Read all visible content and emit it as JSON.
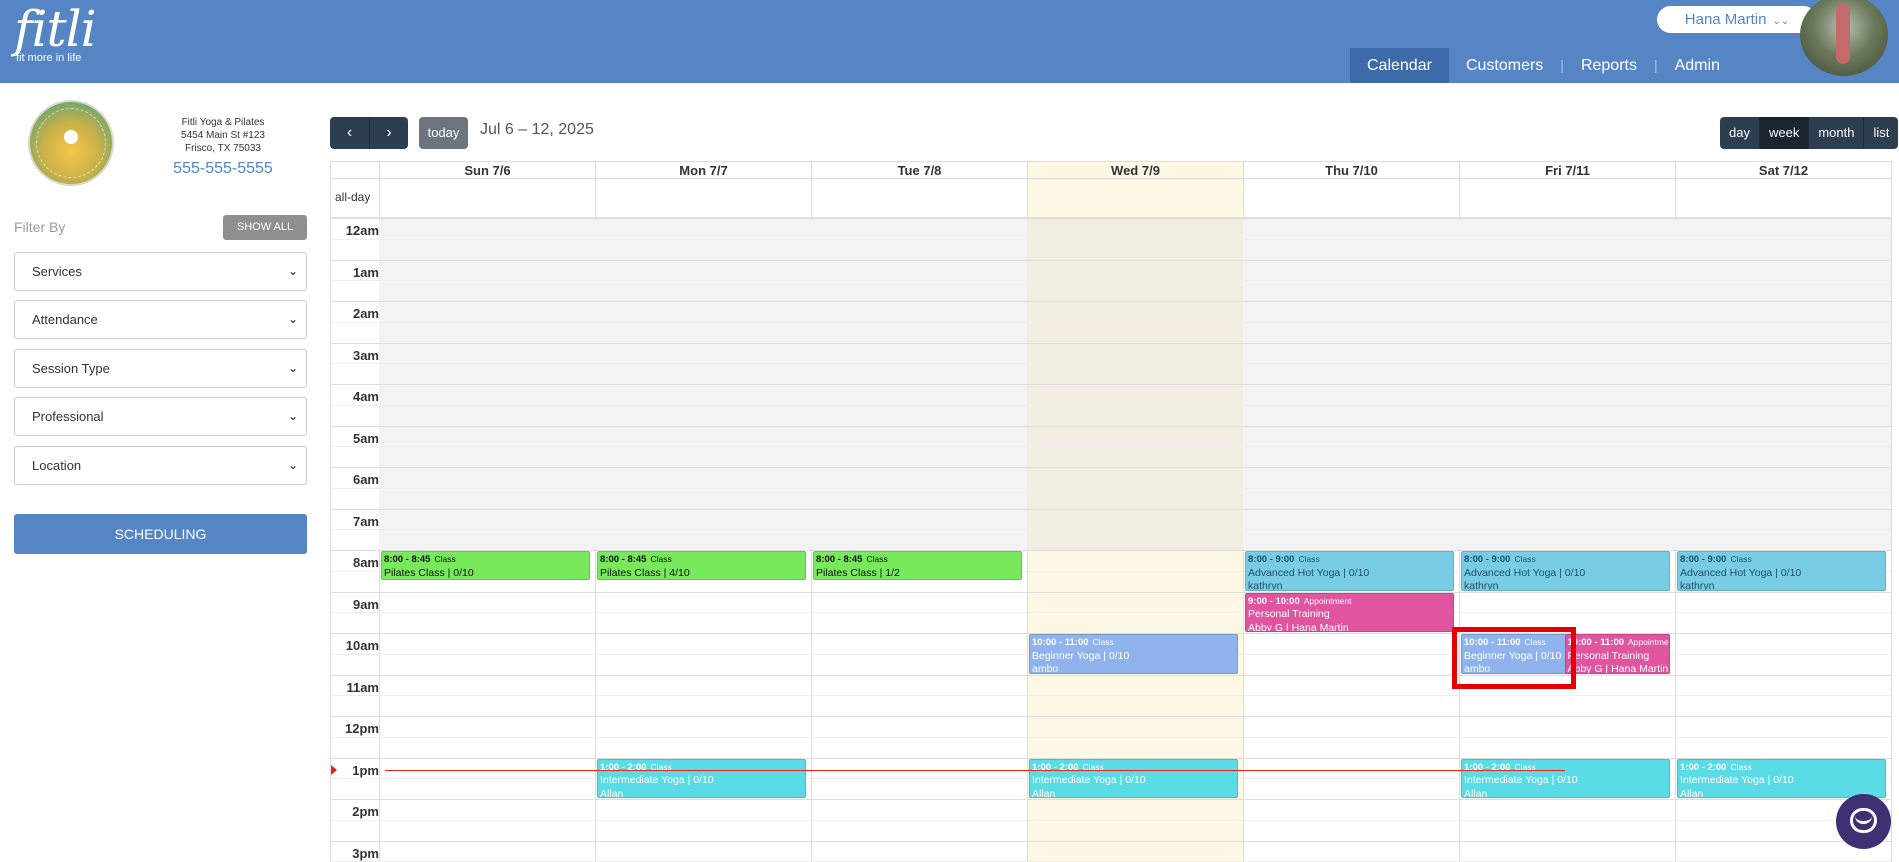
{
  "brand": {
    "name": "fitli",
    "tagline": "fit more in life"
  },
  "user": {
    "name": "Hana Martin"
  },
  "nav": {
    "items": [
      "Calendar",
      "Customers",
      "Reports",
      "Admin"
    ],
    "active": "Calendar"
  },
  "studio": {
    "name": "Fitli Yoga & Pilates",
    "address1": "5454 Main St #123",
    "address2": "Frisco, TX 75033",
    "phone": "555-555-5555"
  },
  "filters": {
    "label": "Filter By",
    "show_all": "SHOW ALL",
    "selects": [
      "Services",
      "Attendance",
      "Session Type",
      "Professional",
      "Location"
    ]
  },
  "scheduling_label": "SCHEDULING",
  "toolbar": {
    "prev": "‹",
    "next": "›",
    "today": "today",
    "range": "Jul 6 – 12, 2025",
    "views": [
      "day",
      "week",
      "month",
      "list"
    ],
    "active_view": "week"
  },
  "calendar": {
    "days": [
      "Sun 7/6",
      "Mon 7/7",
      "Tue 7/8",
      "Wed 7/9",
      "Thu 7/10",
      "Fri 7/11",
      "Sat 7/12"
    ],
    "today_index": 3,
    "allday_label": "all-day",
    "hours": [
      "12am",
      "1am",
      "2am",
      "3am",
      "4am",
      "5am",
      "6am",
      "7am",
      "8am",
      "9am",
      "10am",
      "11am",
      "12pm",
      "1pm",
      "2pm",
      "3pm"
    ],
    "events": [
      {
        "day": 0,
        "start": 8,
        "end": 8.75,
        "time": "8:00 - 8:45",
        "kind": "Class",
        "line1": "Pilates Class | 0/10",
        "line2": "",
        "color": "green"
      },
      {
        "day": 1,
        "start": 8,
        "end": 8.75,
        "time": "8:00 - 8:45",
        "kind": "Class",
        "line1": "Pilates Class | 4/10",
        "line2": "",
        "color": "green"
      },
      {
        "day": 2,
        "start": 8,
        "end": 8.75,
        "time": "8:00 - 8:45",
        "kind": "Class",
        "line1": "Pilates Class | 1/2",
        "line2": "",
        "color": "green"
      },
      {
        "day": 4,
        "start": 8,
        "end": 9,
        "time": "8:00 - 9:00",
        "kind": "Class",
        "line1": "Advanced Hot Yoga | 0/10",
        "line2": "kathryn",
        "color": "blue"
      },
      {
        "day": 5,
        "start": 8,
        "end": 9,
        "time": "8:00 - 9:00",
        "kind": "Class",
        "line1": "Advanced Hot Yoga | 0/10",
        "line2": "kathryn",
        "color": "blue"
      },
      {
        "day": 6,
        "start": 8,
        "end": 9,
        "time": "8:00 - 9:00",
        "kind": "Class",
        "line1": "Advanced Hot Yoga | 0/10",
        "line2": "kathryn",
        "color": "blue"
      },
      {
        "day": 4,
        "start": 9,
        "end": 10,
        "time": "9:00 - 10:00",
        "kind": "Appointment",
        "line1": "Personal Training",
        "line2": "Abby G | Hana Martin",
        "color": "pink"
      },
      {
        "day": 3,
        "start": 10,
        "end": 11,
        "time": "10:00 - 11:00",
        "kind": "Class",
        "line1": "Beginner Yoga | 0/10",
        "line2": "ambo",
        "color": "lblue"
      },
      {
        "day": 5,
        "start": 10,
        "end": 11,
        "time": "10:00 - 11:00",
        "kind": "Class",
        "line1": "Beginner Yoga | 0/10",
        "line2": "ambo",
        "color": "lblue",
        "slot": 0
      },
      {
        "day": 5,
        "start": 10,
        "end": 11,
        "time": "10:00 - 11:00",
        "kind": "Appointment",
        "line1": "Personal Training",
        "line2": "Abby G | Hana Martin",
        "color": "pink",
        "slot": 1
      },
      {
        "day": 1,
        "start": 13,
        "end": 14,
        "time": "1:00 - 2:00",
        "kind": "Class",
        "line1": "Intermediate Yoga | 0/10",
        "line2": "Allan",
        "color": "cyan"
      },
      {
        "day": 3,
        "start": 13,
        "end": 14,
        "time": "1:00 - 2:00",
        "kind": "Class",
        "line1": "Intermediate Yoga | 0/10",
        "line2": "Allan",
        "color": "cyan"
      },
      {
        "day": 5,
        "start": 13,
        "end": 14,
        "time": "1:00 - 2:00",
        "kind": "Class",
        "line1": "Intermediate Yoga | 0/10",
        "line2": "Allan",
        "color": "cyan"
      },
      {
        "day": 6,
        "start": 13,
        "end": 14,
        "time": "1:00 - 2:00",
        "kind": "Class",
        "line1": "Intermediate Yoga | 0/10",
        "line2": "Allan",
        "color": "cyan"
      }
    ]
  },
  "colors": {
    "header": "#5585c5",
    "nav_active": "#3d6aa8",
    "today_bg": "#fcf8e3",
    "off_hours": "#f3f3f3",
    "highlight": "#e60000"
  }
}
